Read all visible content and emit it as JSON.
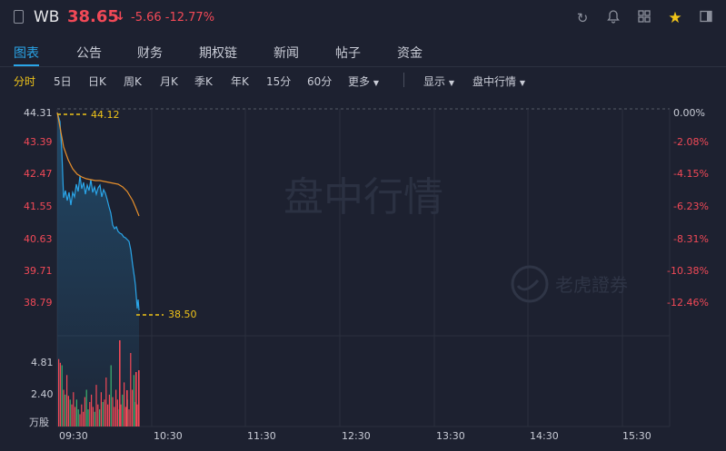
{
  "header": {
    "symbol": "WB",
    "price": "38.65",
    "change": "-5.66",
    "change_pct": "-12.77%",
    "arrow": "↓"
  },
  "tabs": [
    "图表",
    "公告",
    "财务",
    "期权链",
    "新闻",
    "帖子",
    "资金"
  ],
  "periods": [
    "分时",
    "5日",
    "日K",
    "周K",
    "月K",
    "季K",
    "年K",
    "15分",
    "60分",
    "更多"
  ],
  "menus": {
    "display": "显示",
    "source": "盘中行情"
  },
  "price_axis": [
    "44.31",
    "43.39",
    "42.47",
    "41.55",
    "40.63",
    "39.71",
    "38.79"
  ],
  "pct_axis": [
    "0.00%",
    "-2.08%",
    "-4.15%",
    "-6.23%",
    "-8.31%",
    "-10.38%",
    "-12.46%"
  ],
  "ref_labels": {
    "open": "44.12",
    "last": "38.50"
  },
  "volume_axis": [
    "4.81",
    "2.40",
    "万股"
  ],
  "time_axis": [
    "09:30",
    "10:30",
    "11:30",
    "12:30",
    "13:30",
    "14:30",
    "15:30"
  ],
  "watermark": "盘中行情",
  "logo_text": "老虎證券",
  "colors": {
    "up": "#f24957",
    "down": "#3cb371",
    "price_line": "#2aa5e8",
    "avg_line": "#e8902c",
    "ref": "#f0c419"
  }
}
